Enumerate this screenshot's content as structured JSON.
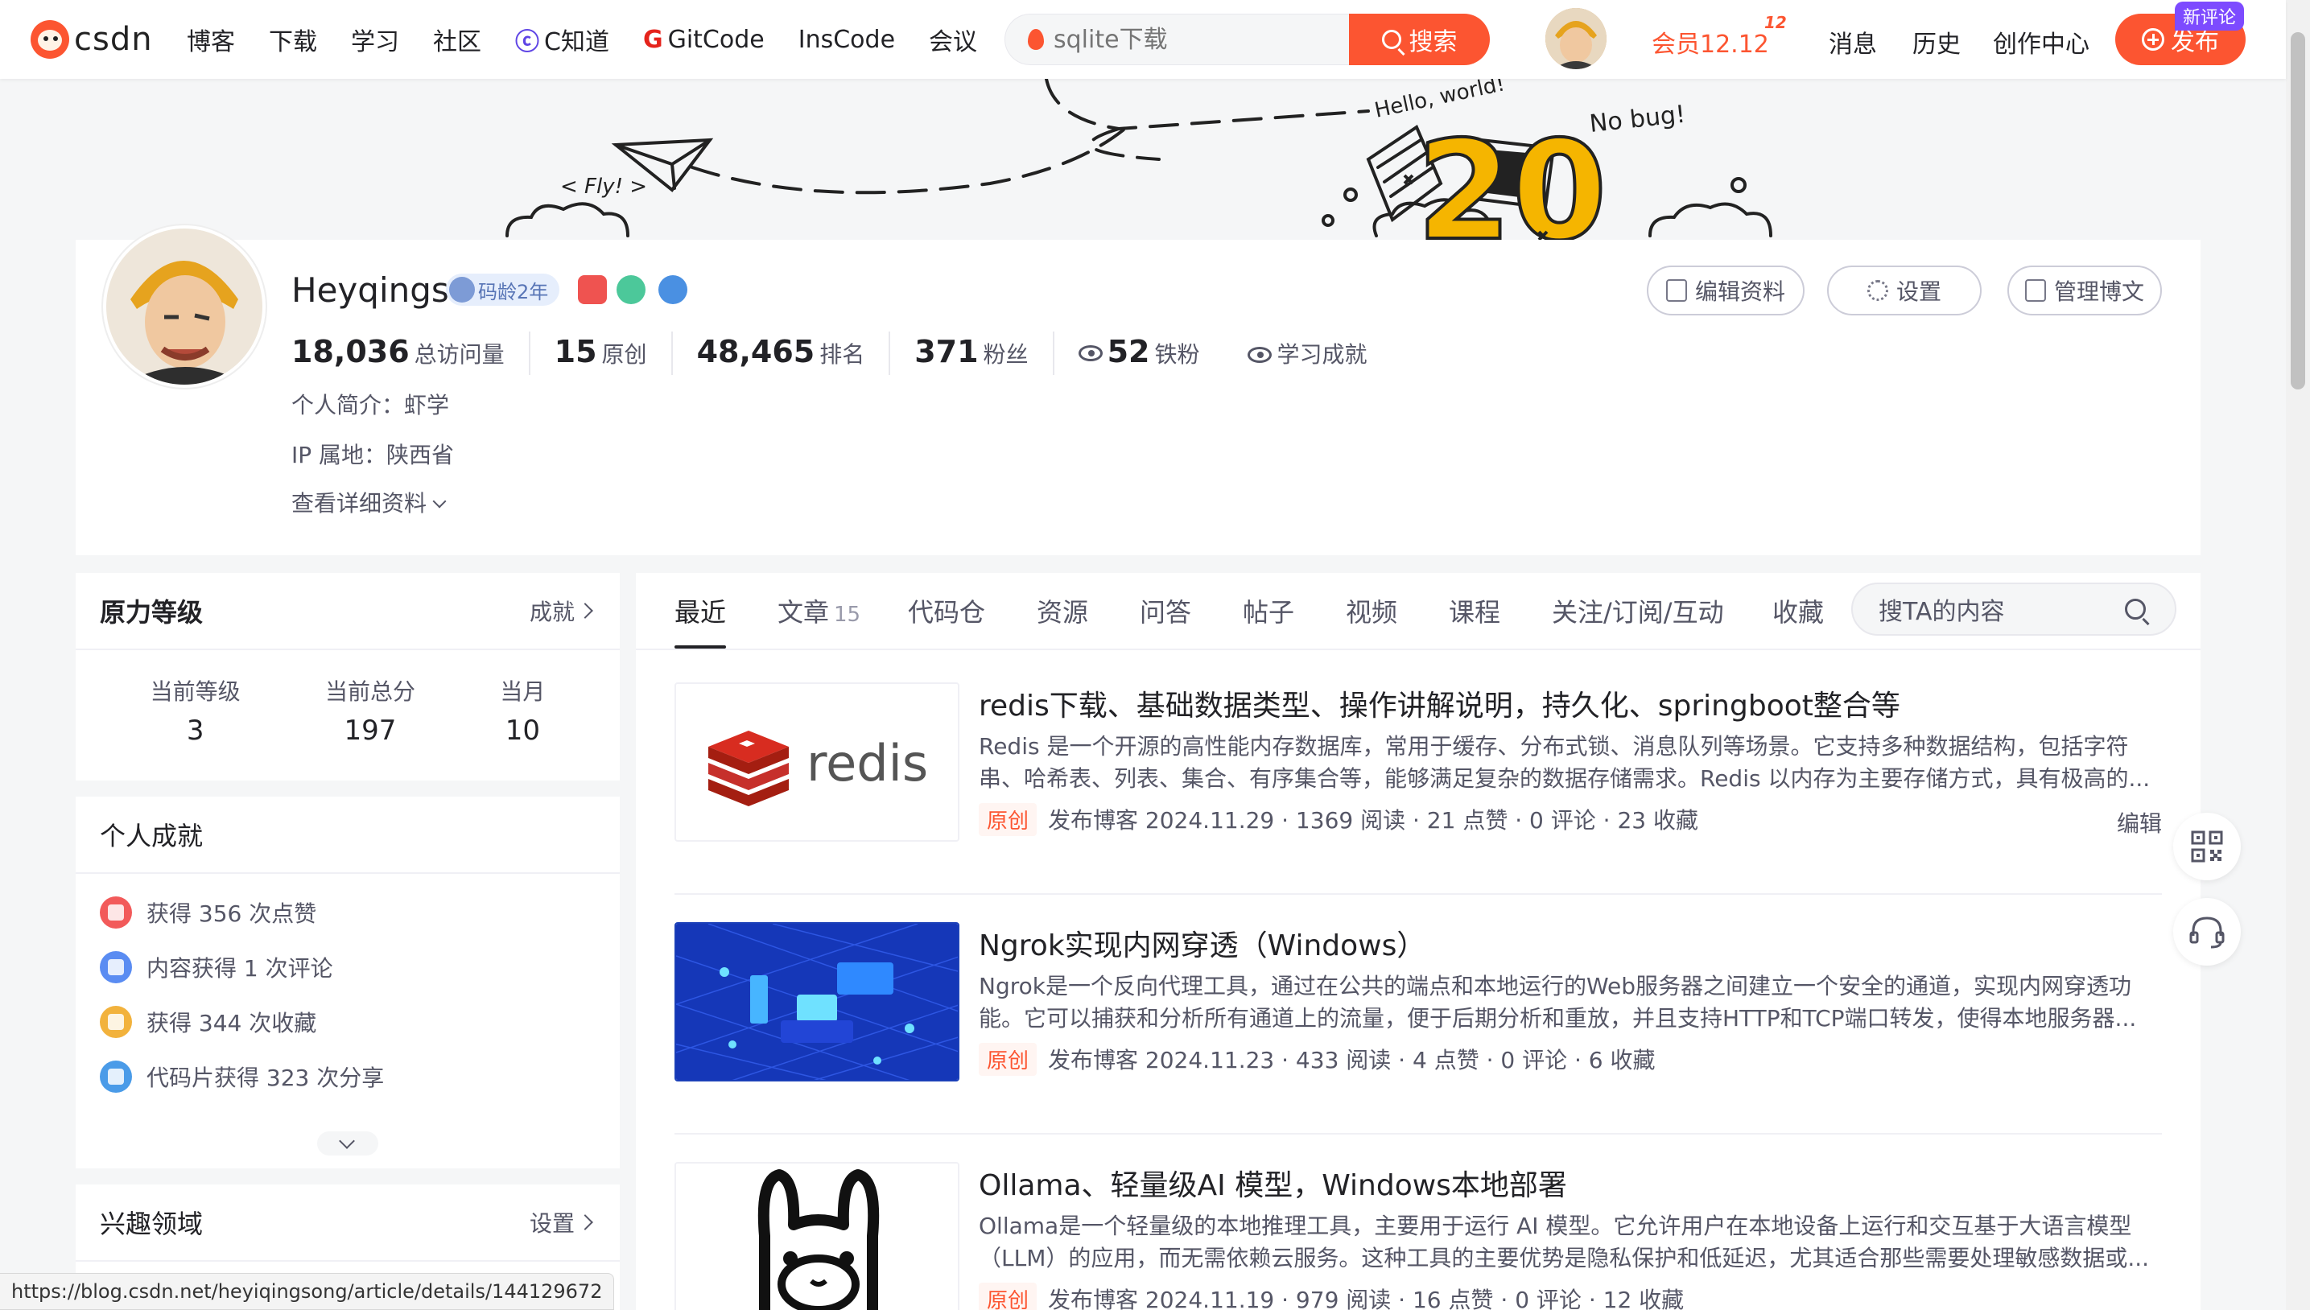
{
  "nav": {
    "logo": "csdn",
    "links": [
      "博客",
      "下载",
      "学习",
      "社区",
      "C知道",
      "GitCode",
      "InsCode",
      "会议"
    ],
    "search_placeholder": "sqlite下载",
    "search_button": "搜索",
    "member": "会员12.12",
    "member_tag": "12",
    "messages": "消息",
    "history": "历史",
    "creator": "创作中心",
    "publish": "发布",
    "new_comment": "新评论"
  },
  "banner": {
    "hello": "Hello, world!",
    "fly": "< Fly! >",
    "nobug": "No bug!",
    "num": "20"
  },
  "profile": {
    "username": "Heyqings",
    "code_age": "码龄2年",
    "stats": [
      {
        "num": "18,036",
        "label": "总访问量"
      },
      {
        "num": "15",
        "label": "原创"
      },
      {
        "num": "48,465",
        "label": "排名"
      },
      {
        "num": "371",
        "label": "粉丝"
      },
      {
        "num": "52",
        "label": "铁粉"
      }
    ],
    "learning": "学习成就",
    "bio": "个人简介：虾学",
    "ip": "IP 属地：陕西省",
    "detail": "查看详细资料",
    "buttons": {
      "edit": "编辑资料",
      "settings": "设置",
      "manage": "管理博文"
    }
  },
  "level": {
    "title": "原力等级",
    "more": "成就",
    "cols": [
      {
        "label": "当前等级",
        "value": "3"
      },
      {
        "label": "当前总分",
        "value": "197"
      },
      {
        "label": "当月",
        "value": "10"
      }
    ]
  },
  "achievements": {
    "title": "个人成就",
    "items": [
      {
        "text": "获得 356 次点赞",
        "color": "#f25a5a"
      },
      {
        "text": "内容获得 1 次评论",
        "color": "#5a8cf2"
      },
      {
        "text": "获得 344 次收藏",
        "color": "#f2b23c"
      },
      {
        "text": "代码片获得 323 次分享",
        "color": "#4a9be8"
      }
    ]
  },
  "interests": {
    "title": "兴趣领域",
    "more": "设置"
  },
  "tabs": {
    "items": [
      "最近",
      "文章",
      "代码仓",
      "资源",
      "问答",
      "帖子",
      "视频",
      "课程",
      "关注/订阅/互动",
      "收藏"
    ],
    "article_count": "15",
    "search_placeholder": "搜TA的内容"
  },
  "articles": [
    {
      "title": "redis下载、基础数据类型、操作讲解说明，持久化、springboot整合等",
      "desc": "Redis 是一个开源的高性能内存数据库，常用于缓存、分布式锁、消息队列等场景。它支持多种数据结构，包括字符串、哈希表、列表、集合、有序集合等，能够满足复杂的数据存储需求。Redis 以内存为主要存储方式，具有极高的...",
      "tag": "原创",
      "meta": "发布博客 2024.11.29 · 1369 阅读 · 21 点赞 · 0 评论 · 23 收藏",
      "edit": "编辑",
      "thumb_text": "redis"
    },
    {
      "title": "Ngrok实现内网穿透（Windows）",
      "desc": "Ngrok是一个反向代理工具，通过在公共的端点和本地运行的Web服务器之间建立一个安全的通道，实现内网穿透功能。它可以捕获和分析所有通道上的流量，便于后期分析和重放，并且支持HTTP和TCP端口转发，使得本地服务器...",
      "tag": "原创",
      "meta": "发布博客 2024.11.23 · 433 阅读 · 4 点赞 · 0 评论 · 6 收藏"
    },
    {
      "title": "Ollama、轻量级AI 模型，Windows本地部署",
      "desc": "Ollama是一个轻量级的本地推理工具，主要用于运行 AI 模型。它允许用户在本地设备上运行和交互基于大语言模型（LLM）的应用，而无需依赖云服务。这种工具的主要优势是隐私保护和低延迟，尤其适合那些需要处理敏感数据或...",
      "tag": "原创",
      "meta": "发布博客 2024.11.19 · 979 阅读 · 16 点赞 · 0 评论 · 12 收藏"
    }
  ],
  "status_url": "https://blog.csdn.net/heyiqingsong/article/details/144129672",
  "colors": {
    "brand": "#fc5531",
    "bg": "#f5f6f7"
  }
}
